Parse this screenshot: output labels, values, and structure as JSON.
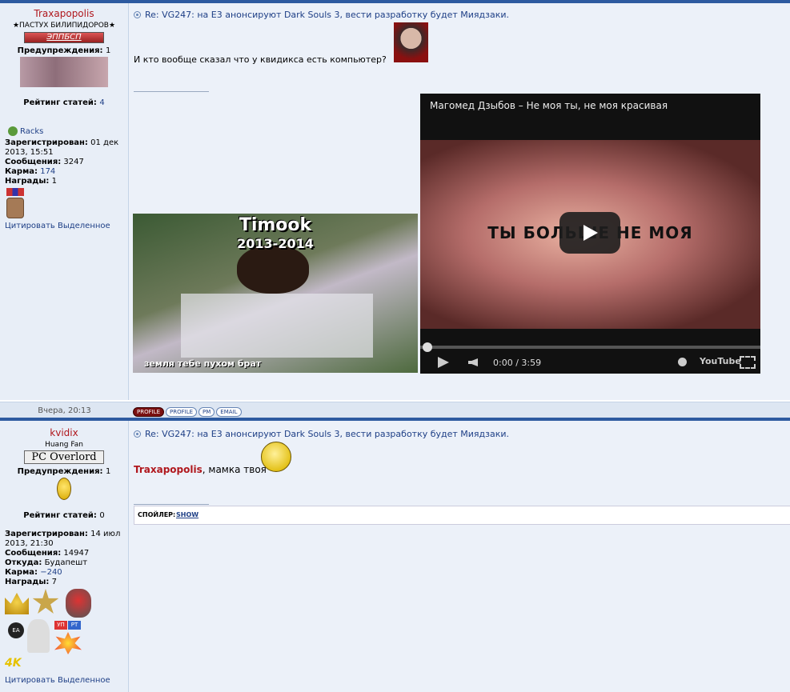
{
  "posts": [
    {
      "author": "Traxapopolis",
      "title": "★ПАСТУХ БИЛИПИДОРОВ★",
      "userbar": "ЭППБСП",
      "warnings_label": "Предупреждения:",
      "warnings": "1",
      "rating_label": "Рейтинг статей:",
      "rating": "4",
      "gamertag": "Racks",
      "registered_label": "Зарегистрирован:",
      "registered": "01 дек 2013, 15:51",
      "messages_label": "Сообщения:",
      "messages": "3247",
      "karma_label": "Карма:",
      "karma": "174",
      "awards_label": "Награды:",
      "awards": "1",
      "actions": "Цитировать Выделенное",
      "subject": "Re: VG247: на E3 анонсируют Dark Souls 3, вести разработку будет Миядзаки.",
      "body": "И кто вообще сказал что у квидикса есть компьютер?",
      "meme": {
        "title": "Timook",
        "years": "2013-2014",
        "caption": "земля тебе пухом брат"
      },
      "video": {
        "title": "Магомед Дзыбов – Не моя ты, не моя красивая",
        "overlay": "ТЫ БОЛЬШЕ НЕ МОЯ",
        "time": "0:00 / 3:59",
        "brand": "YouTube"
      },
      "date": "Вчера, 20:13",
      "footer_buttons": [
        "PROFILE",
        "PROFILE",
        "PM",
        "EMAIL"
      ]
    },
    {
      "author": "kvidix",
      "title": "Huang Fan",
      "userbar": "PC Overlord",
      "warnings_label": "Предупреждения:",
      "warnings": "1",
      "rating_label": "Рейтинг статей:",
      "rating": "0",
      "registered_label": "Зарегистрирован:",
      "registered": "14 июл 2013, 21:30",
      "messages_label": "Сообщения:",
      "messages": "14947",
      "from_label": "Откуда:",
      "from": "Будапешт",
      "karma_label": "Карма:",
      "karma": "−240",
      "awards_label": "Награды:",
      "awards": "7",
      "actions": "Цитировать Выделенное",
      "subject": "Re: VG247: на E3 анонсируют Dark Souls 3, вести разработку будет Миядзаки.",
      "mention": "Traxapopolis",
      "body": ", мамка твоя",
      "spoiler_label": "СПОЙЛЕР:",
      "spoiler_show": "SHOW",
      "badge_4k": "4K",
      "badge_up": "УП",
      "badge_rt": "РТ",
      "badge_ea": "EA"
    }
  ]
}
